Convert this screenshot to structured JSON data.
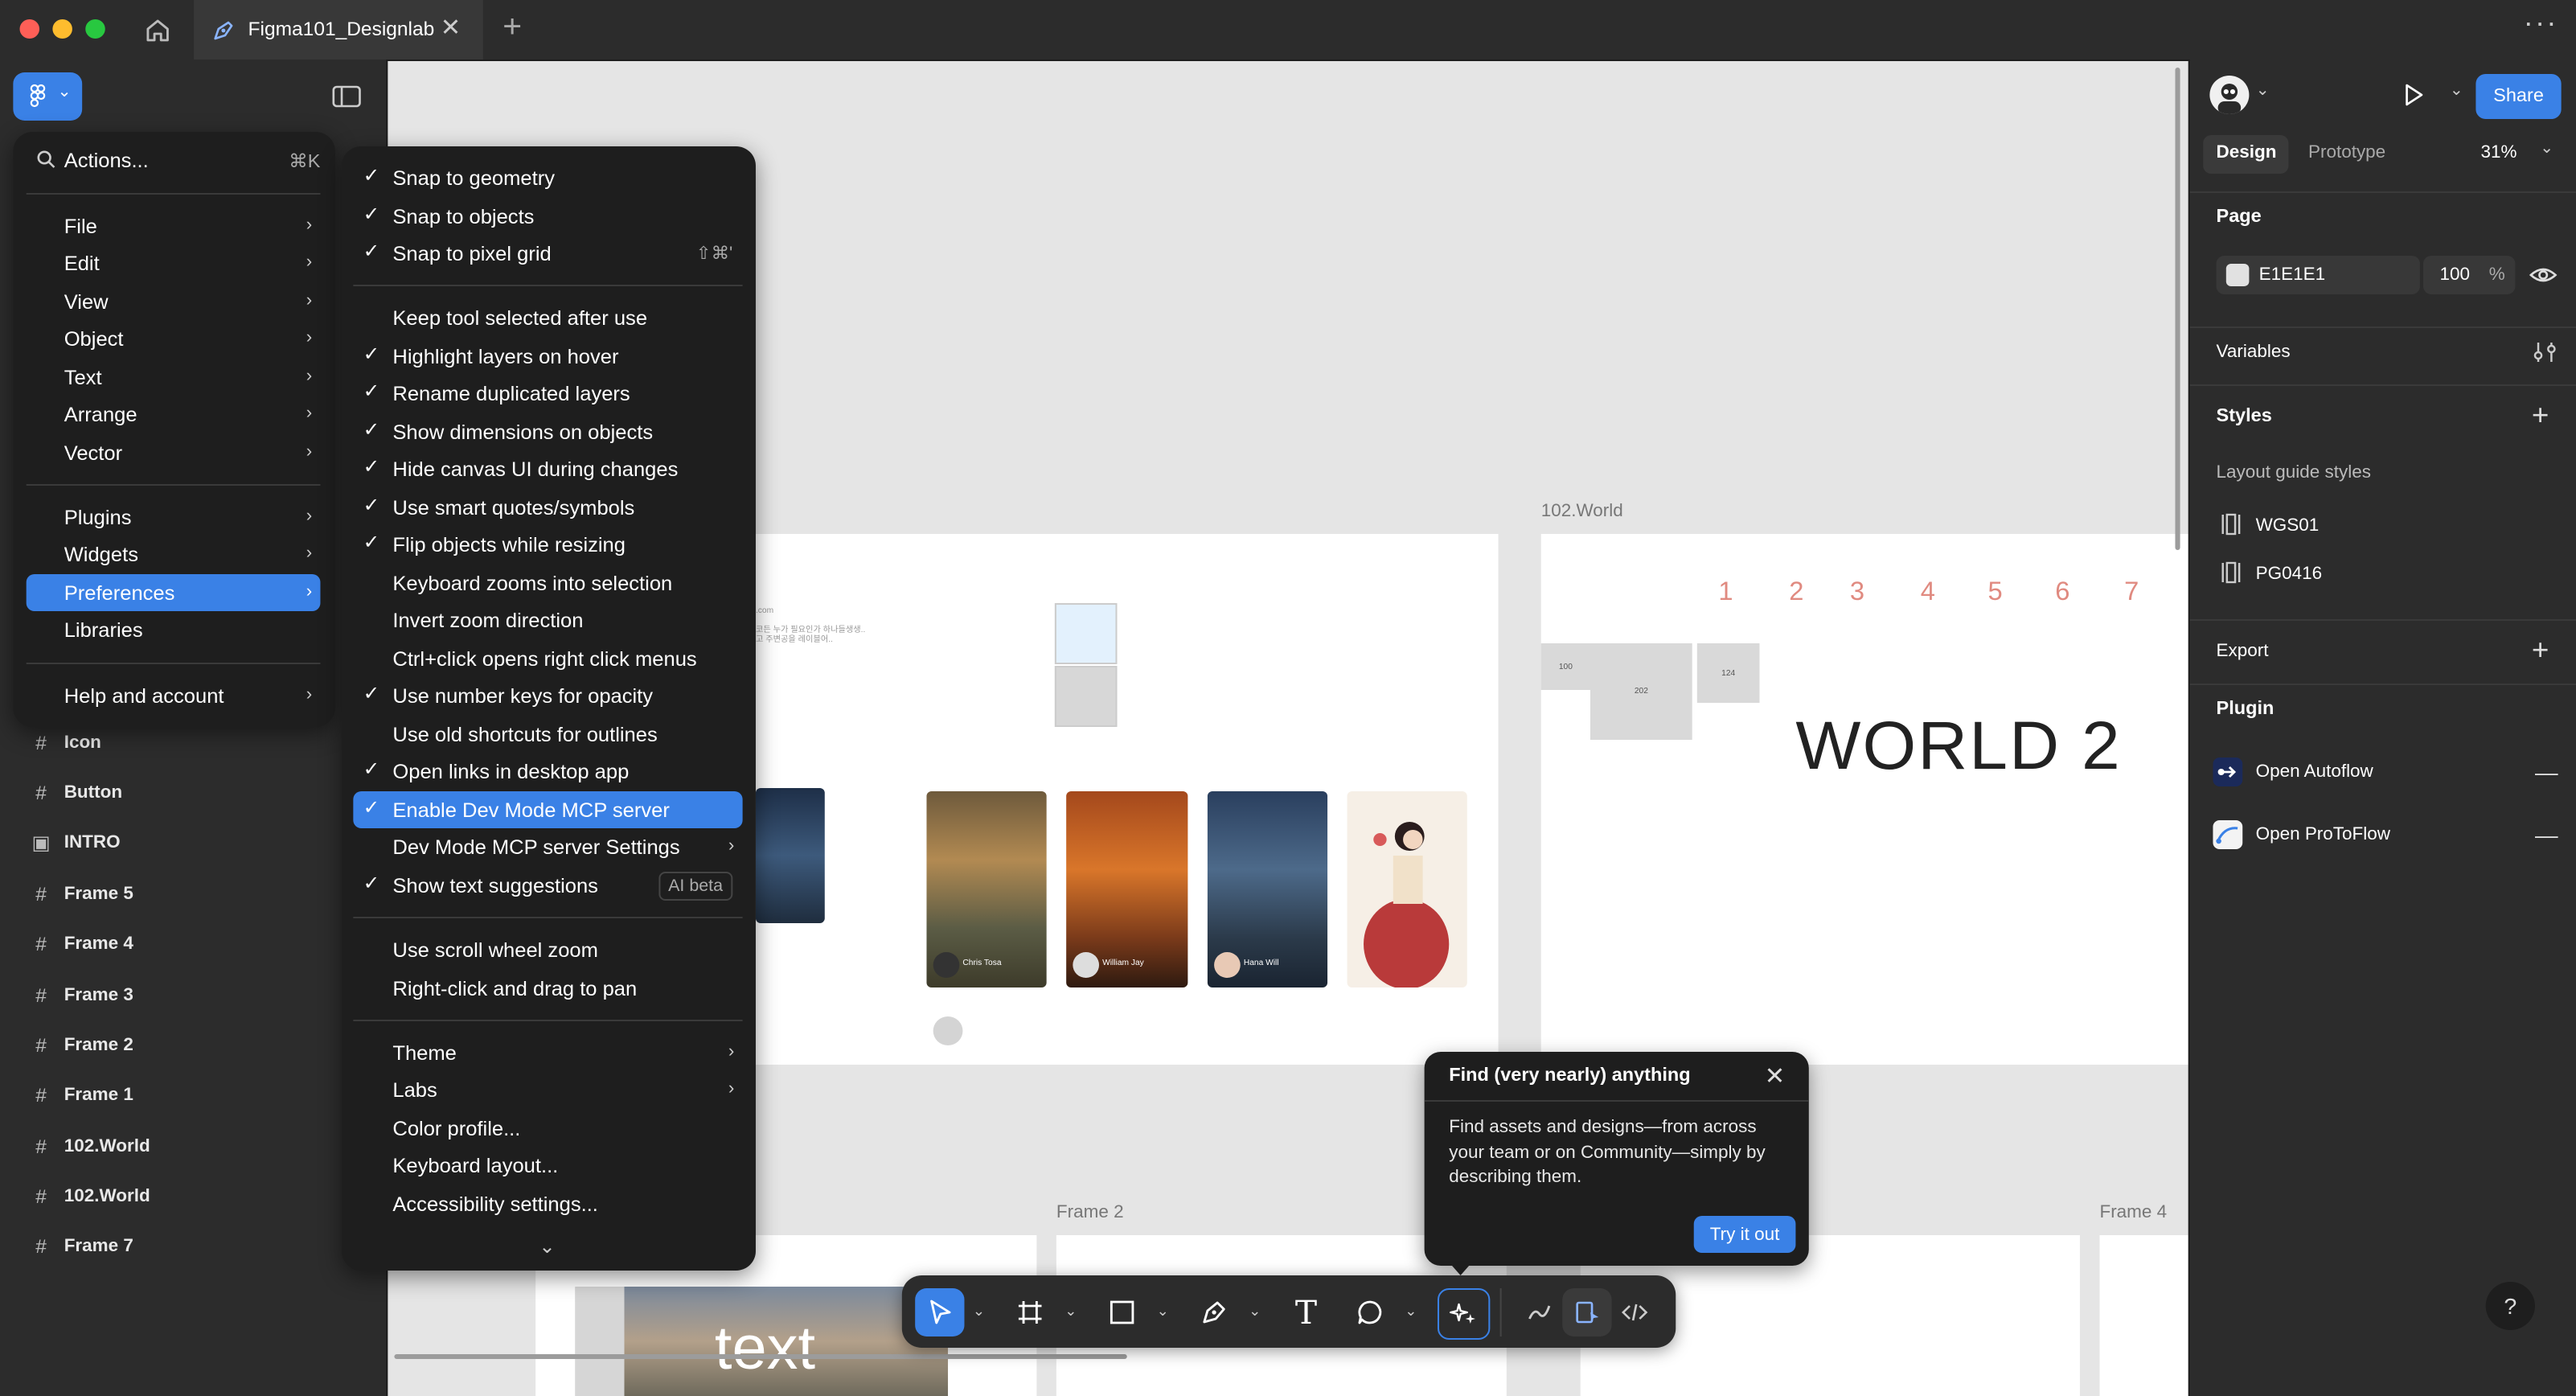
{
  "titlebar": {
    "tab_title": "Figma101_Designlab",
    "home_icon": "home-icon",
    "add_tab_icon": "plus-icon",
    "more_icon": "more-icon",
    "traffic_colors": [
      "#fe5f57",
      "#febc2e",
      "#28c840"
    ]
  },
  "main_menu": {
    "search_label": "Actions...",
    "search_shortcut": "⌘K",
    "items": [
      {
        "label": "File"
      },
      {
        "label": "Edit"
      },
      {
        "label": "View"
      },
      {
        "label": "Object"
      },
      {
        "label": "Text"
      },
      {
        "label": "Arrange"
      },
      {
        "label": "Vector"
      },
      {
        "label": "Plugins"
      },
      {
        "label": "Widgets"
      },
      {
        "label": "Preferences"
      },
      {
        "label": "Libraries"
      },
      {
        "label": "Help and account"
      }
    ]
  },
  "preferences_menu": {
    "items": [
      {
        "label": "Snap to geometry",
        "checked": true
      },
      {
        "label": "Snap to objects",
        "checked": true
      },
      {
        "label": "Snap to pixel grid",
        "checked": true,
        "shortcut": "⇧⌘'"
      },
      {
        "label": "Keep tool selected after use",
        "checked": false
      },
      {
        "label": "Highlight layers on hover",
        "checked": true
      },
      {
        "label": "Rename duplicated layers",
        "checked": true
      },
      {
        "label": "Show dimensions on objects",
        "checked": true
      },
      {
        "label": "Hide canvas UI during changes",
        "checked": true
      },
      {
        "label": "Use smart quotes/symbols",
        "checked": true
      },
      {
        "label": "Flip objects while resizing",
        "checked": true
      },
      {
        "label": "Keyboard zooms into selection",
        "checked": false
      },
      {
        "label": "Invert zoom direction",
        "checked": false
      },
      {
        "label": "Ctrl+click opens right click menus",
        "checked": false
      },
      {
        "label": "Use number keys for opacity",
        "checked": true
      },
      {
        "label": "Use old shortcuts for outlines",
        "checked": false
      },
      {
        "label": "Open links in desktop app",
        "checked": true
      },
      {
        "label": "Enable Dev Mode MCP server",
        "checked": true,
        "selected": true
      },
      {
        "label": "Dev Mode MCP server Settings",
        "checked": false,
        "submenu": true
      },
      {
        "label": "Show text suggestions",
        "checked": true,
        "badge": "AI beta"
      },
      {
        "label": "Use scroll wheel zoom",
        "checked": false
      },
      {
        "label": "Right-click and drag to pan",
        "checked": false
      },
      {
        "label": "Theme",
        "submenu": true
      },
      {
        "label": "Labs",
        "submenu": true
      },
      {
        "label": "Color profile..."
      },
      {
        "label": "Keyboard layout..."
      },
      {
        "label": "Accessibility settings..."
      }
    ],
    "scroll_icon": "chevron-down-icon"
  },
  "layers": [
    {
      "label": "Icon",
      "icon": "#"
    },
    {
      "label": "Button",
      "icon": "#"
    },
    {
      "label": "INTRO",
      "icon": "▣"
    },
    {
      "label": "Frame 5",
      "icon": "#"
    },
    {
      "label": "Frame 4",
      "icon": "#"
    },
    {
      "label": "Frame 3",
      "icon": "#"
    },
    {
      "label": "Frame 2",
      "icon": "#"
    },
    {
      "label": "Frame 1",
      "icon": "#"
    },
    {
      "label": "102.World",
      "icon": "#"
    },
    {
      "label": "102.World",
      "icon": "#"
    },
    {
      "label": "Frame 7",
      "icon": "#"
    }
  ],
  "canvas": {
    "frame_world_label": "102.World",
    "numbers": [
      "1",
      "2",
      "3",
      "4",
      "5",
      "6",
      "7"
    ],
    "box_labels": [
      "100",
      "202",
      "124"
    ],
    "world_title": "WORLD 2",
    "frame2_label": "Frame 2",
    "frame4_label": "Frame 4",
    "card_captions": [
      "Chris Tosa",
      "William Jay",
      "Hana Will"
    ],
    "bottom_text": "text"
  },
  "popup": {
    "title": "Find (very nearly) anything",
    "body": "Find assets and designs—from across your team or on Community—simply by describing them.",
    "button": "Try it out"
  },
  "right_panel": {
    "share": "Share",
    "tabs": [
      "Design",
      "Prototype"
    ],
    "zoom": "31%",
    "page_heading": "Page",
    "page_color": "E1E1E1",
    "page_opacity": "100",
    "page_opacity_unit": "%",
    "variables": "Variables",
    "styles": "Styles",
    "layout_guide_styles": "Layout guide styles",
    "guide_styles": [
      "WGS01",
      "PG0416"
    ],
    "export": "Export",
    "plugin": "Plugin",
    "plugins": [
      "Open Autoflow",
      "Open ProToFlow"
    ],
    "help": "?"
  },
  "colors": {
    "accent": "#3a81e6",
    "numbers": "#e08a80"
  }
}
